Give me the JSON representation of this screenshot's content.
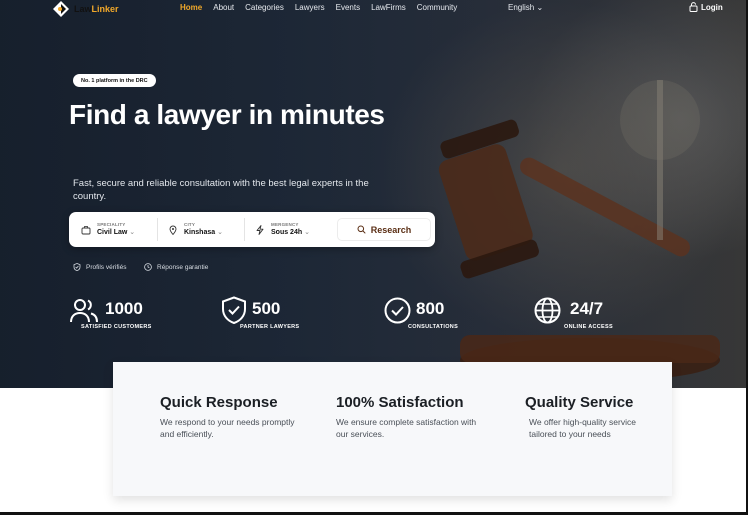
{
  "nav": {
    "logo": {
      "prefix": "Law",
      "suffix": "Linker"
    },
    "links": [
      "Home",
      "About",
      "Categories",
      "Lawyers",
      "Events",
      "LawFirms",
      "Community"
    ],
    "active": "Home",
    "language": "English",
    "login": "Login"
  },
  "hero": {
    "badge": "No. 1 platform in the DRC",
    "title": "Find a lawyer in minutes",
    "subtitle": "Fast, secure and reliable consultation with the best legal experts in the country."
  },
  "search": {
    "speciality": {
      "label": "SPECIALITY",
      "value": "Civil Law"
    },
    "city": {
      "label": "CITY",
      "value": "Kinshasa"
    },
    "emergency": {
      "label": "MERGENCY",
      "value": "Sous 24h"
    },
    "button": "Research"
  },
  "assurances": [
    "Profils vérifiés",
    "Réponse garantie"
  ],
  "stats": [
    {
      "value": "1000",
      "caption": "SATISFIED CUSTOMERS",
      "icon": "users-icon"
    },
    {
      "value": "500",
      "caption": "PARTNER LAWYERS",
      "icon": "shield-check-icon"
    },
    {
      "value": "800",
      "caption": "CONSULTATIONS",
      "icon": "check-circle-icon"
    },
    {
      "value": "24/7",
      "caption": "ONLINE ACCESS",
      "icon": "globe-icon"
    }
  ],
  "features": [
    {
      "title": "Quick Response",
      "text": "We respond to your needs promptly and efficiently."
    },
    {
      "title": "100% Satisfaction",
      "text": "We ensure complete satisfaction with our services."
    },
    {
      "title": "Quality Service",
      "text": "We offer high-quality service tailored to your needs"
    }
  ],
  "colors": {
    "accent": "#f0a82a",
    "heroBg": "#1e2a3a",
    "button_text": "#5a2e14"
  }
}
